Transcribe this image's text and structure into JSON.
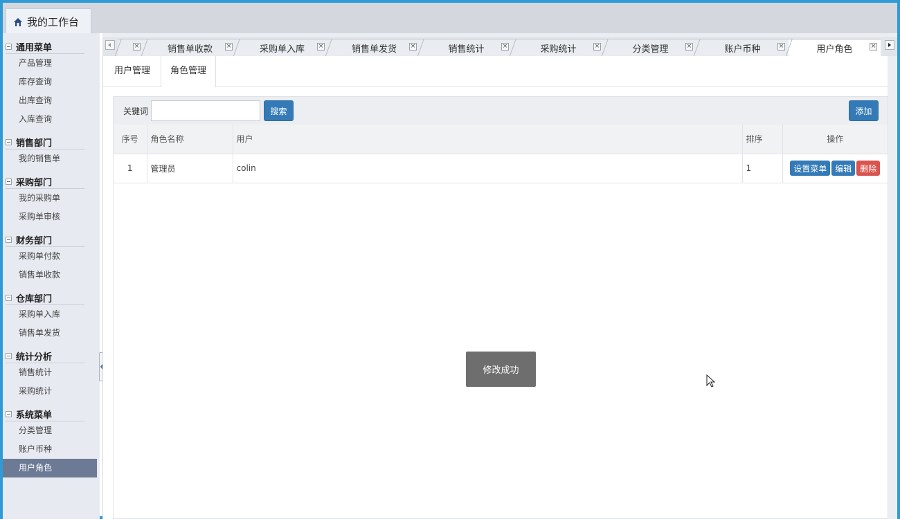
{
  "workbench": {
    "title": "我的工作台"
  },
  "sidebar": {
    "groups": [
      {
        "title": "通用菜单",
        "items": [
          "产品管理",
          "库存查询",
          "出库查询",
          "入库查询"
        ]
      },
      {
        "title": "销售部门",
        "items": [
          "我的销售单"
        ]
      },
      {
        "title": "采购部门",
        "items": [
          "我的采购单",
          "采购单审核"
        ]
      },
      {
        "title": "财务部门",
        "items": [
          "采购单付款",
          "销售单收款"
        ]
      },
      {
        "title": "仓库部门",
        "items": [
          "采购单入库",
          "销售单发货"
        ]
      },
      {
        "title": "统计分析",
        "items": [
          "销售统计",
          "采购统计"
        ]
      },
      {
        "title": "系统菜单",
        "items": [
          "分类管理",
          "账户币种",
          "用户角色"
        ]
      }
    ],
    "active_item": "用户角色"
  },
  "tabs": [
    "销售单收款",
    "采购单入库",
    "销售单发货",
    "销售统计",
    "采购统计",
    "分类管理",
    "账户币种",
    "用户角色"
  ],
  "active_tab": "用户角色",
  "subtabs": {
    "users": "用户管理",
    "roles": "角色管理"
  },
  "toolbar": {
    "keyword_label": "关键词",
    "keyword_value": "",
    "search_label": "搜索",
    "add_label": "添加"
  },
  "table": {
    "headers": {
      "no": "序号",
      "name": "角色名称",
      "user": "用户",
      "sort": "排序",
      "op": "操作"
    },
    "rows": [
      {
        "no": "1",
        "name": "管理员",
        "user": "colin",
        "sort": "1"
      }
    ],
    "actions": {
      "menu": "设置菜单",
      "edit": "编辑",
      "delete": "删除"
    }
  },
  "toast": {
    "message": "修改成功"
  },
  "colors": {
    "frame": "#2f9bd6",
    "primary": "#337ab7",
    "danger": "#d9534f",
    "sidebar_active": "#6c7a96"
  }
}
